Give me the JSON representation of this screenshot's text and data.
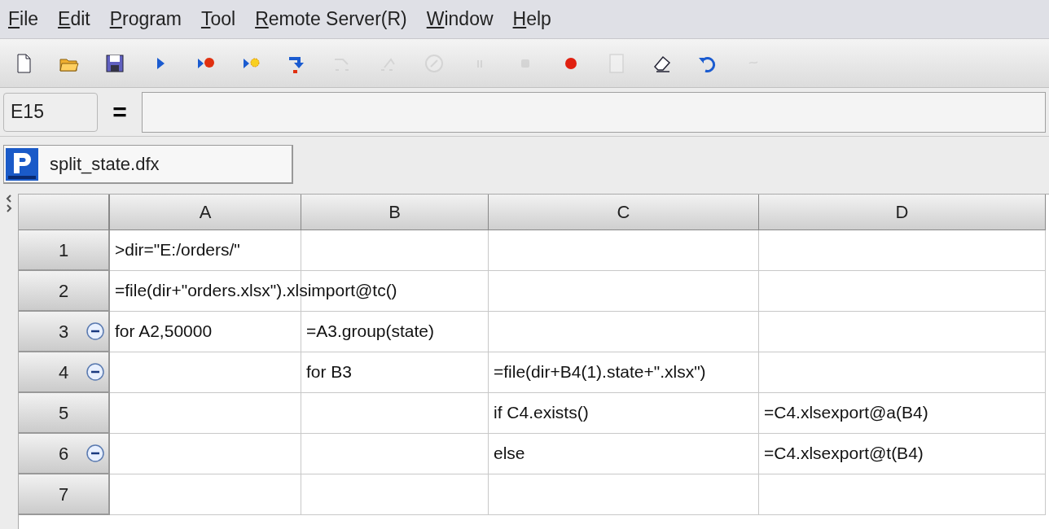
{
  "menu": [
    {
      "label": "File"
    },
    {
      "label": "Edit"
    },
    {
      "label": "Program"
    },
    {
      "label": "Tool"
    },
    {
      "label": "Remote Server(R)"
    },
    {
      "label": "Window"
    },
    {
      "label": "Help"
    }
  ],
  "toolbar": [
    {
      "kind": "new",
      "disabled": false
    },
    {
      "kind": "open",
      "disabled": false
    },
    {
      "kind": "save",
      "disabled": false
    },
    {
      "kind": "run",
      "disabled": false
    },
    {
      "kind": "debug",
      "disabled": false
    },
    {
      "kind": "step",
      "disabled": false
    },
    {
      "kind": "stepin",
      "disabled": false
    },
    {
      "kind": "stepover",
      "disabled": true
    },
    {
      "kind": "stepout",
      "disabled": true
    },
    {
      "kind": "stop",
      "disabled": true
    },
    {
      "kind": "pause",
      "disabled": true
    },
    {
      "kind": "halt",
      "disabled": true
    },
    {
      "kind": "breakpoint",
      "disabled": false
    },
    {
      "kind": "page",
      "disabled": true
    },
    {
      "kind": "eraser",
      "disabled": false
    },
    {
      "kind": "undo",
      "disabled": false
    },
    {
      "kind": "redo",
      "disabled": true
    }
  ],
  "formula_bar": {
    "cell": "E15",
    "equals": "="
  },
  "file_tab": {
    "title": "split_state.dfx"
  },
  "grid": {
    "columns": [
      "A",
      "B",
      "C",
      "D"
    ],
    "rows": [
      {
        "label": "1",
        "kind": "plain",
        "cells": [
          ">dir=\"E:/orders/\"",
          "",
          "",
          ""
        ]
      },
      {
        "label": "2",
        "kind": "plain",
        "cells": [
          "=file(dir+\"orders.xlsx\").xlsimport@tc()",
          "",
          "",
          ""
        ]
      },
      {
        "label": "3",
        "kind": "block",
        "cells": [
          "for A2,50000",
          "=A3.group(state)",
          "",
          ""
        ]
      },
      {
        "label": "4",
        "kind": "block",
        "cells": [
          "",
          "for B3",
          "=file(dir+B4(1).state+\".xlsx\")",
          ""
        ]
      },
      {
        "label": "5",
        "kind": "plain",
        "cells": [
          "",
          "",
          "if C4.exists()",
          "=C4.xlsexport@a(B4)"
        ]
      },
      {
        "label": "6",
        "kind": "block",
        "cells": [
          "",
          "",
          "else",
          "=C4.xlsexport@t(B4)"
        ]
      },
      {
        "label": "7",
        "kind": "plain",
        "cells": [
          "",
          "",
          "",
          ""
        ]
      }
    ]
  }
}
